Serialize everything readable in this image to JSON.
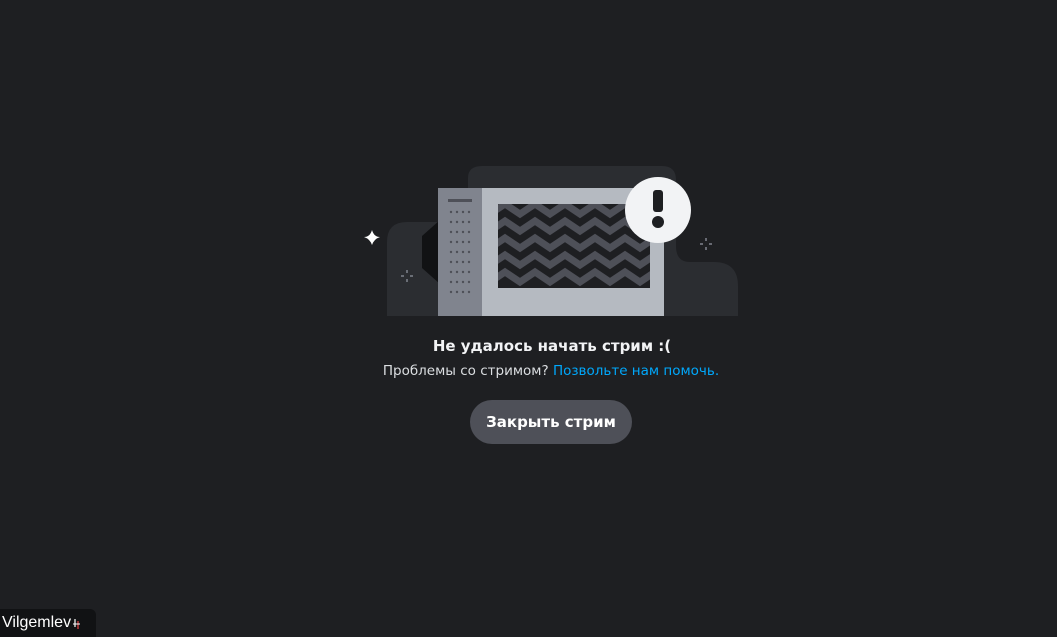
{
  "colors": {
    "background": "#1e1f22",
    "button_bg": "#4e5058",
    "link": "#00a8fc",
    "illustration_dark": "#2b2d31"
  },
  "error": {
    "title": "Не удалось начать стрим :(",
    "subtitle_text": "Проблемы со стримом?",
    "help_link": "Позвольте нам помочь."
  },
  "actions": {
    "close_stream_label": "Закрыть стрим"
  },
  "user": {
    "name": "Vilgemlev",
    "status_icon": "mic-icon"
  },
  "illustration": {
    "icons": [
      "sparkle-icon",
      "exclamation-icon",
      "broken-screen"
    ]
  }
}
